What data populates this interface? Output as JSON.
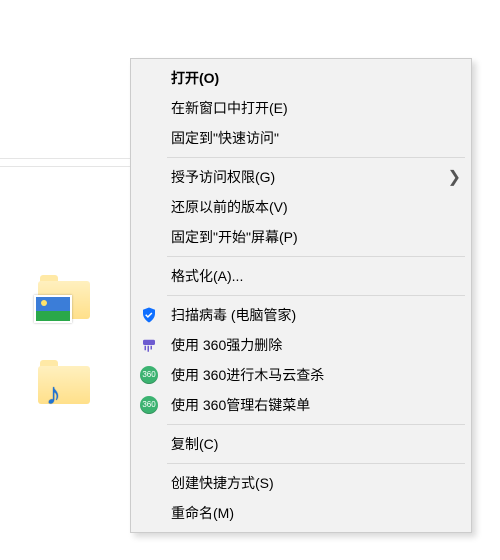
{
  "context_menu": {
    "items": [
      {
        "label": "打开(O)",
        "bold": true
      },
      {
        "label": "在新窗口中打开(E)"
      },
      {
        "label": "固定到\"快速访问\""
      },
      {
        "sep": true
      },
      {
        "label": "授予访问权限(G)",
        "submenu": true
      },
      {
        "label": "还原以前的版本(V)"
      },
      {
        "label": "固定到\"开始\"屏幕(P)"
      },
      {
        "sep": true
      },
      {
        "label": "格式化(A)..."
      },
      {
        "sep": true
      },
      {
        "label": "扫描病毒 (电脑管家)",
        "icon": "shield"
      },
      {
        "label": "使用 360强力删除",
        "icon": "shred"
      },
      {
        "label": "使用 360进行木马云查杀",
        "icon": "360"
      },
      {
        "label": "使用 360管理右键菜单",
        "icon": "360"
      },
      {
        "sep": true
      },
      {
        "label": "复制(C)"
      },
      {
        "sep": true
      },
      {
        "label": "创建快捷方式(S)"
      },
      {
        "label": "重命名(M)"
      }
    ]
  },
  "icons": {
    "shield": "qq-guard-shield-icon",
    "shred": "360-shredder-icon",
    "360": "360-safe-icon"
  },
  "desktop": {
    "folders": [
      {
        "kind": "pictures"
      },
      {
        "kind": "music"
      }
    ]
  }
}
